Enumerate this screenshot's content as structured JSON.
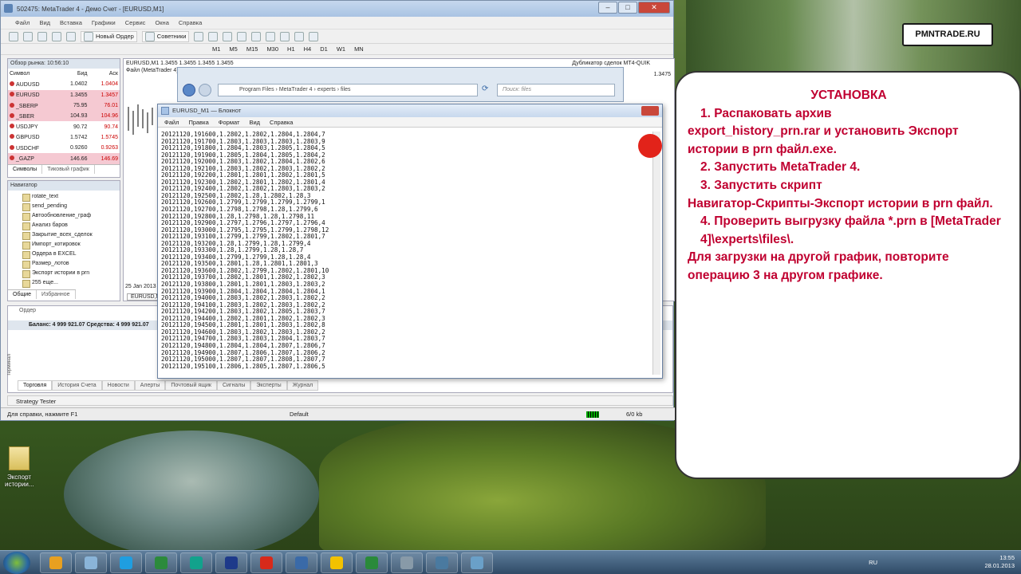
{
  "window": {
    "title": "502475: MetaTrader 4 - Демо Счет - [EURUSD,M1]"
  },
  "menu": [
    "Файл",
    "Вид",
    "Вставка",
    "Графики",
    "Сервис",
    "Окна",
    "Справка"
  ],
  "toolbar": {
    "new_order": "Новый Ордер",
    "advisors": "Советники",
    "timeframes": [
      "M1",
      "M5",
      "M15",
      "M30",
      "H1",
      "H4",
      "D1",
      "W1",
      "MN"
    ]
  },
  "market_watch": {
    "title": "Обзор рынка: 10:56:10",
    "headers": [
      "Символ",
      "Бид",
      "Аск"
    ],
    "rows": [
      {
        "symbol": "AUDUSD",
        "bid": "1.0402",
        "ask": "1.0404"
      },
      {
        "symbol": "EURUSD",
        "bid": "1.3455",
        "ask": "1.3457"
      },
      {
        "symbol": "_SBERP",
        "bid": "75.95",
        "ask": "76.01"
      },
      {
        "symbol": "_SBER",
        "bid": "104.93",
        "ask": "104.96"
      },
      {
        "symbol": "USDJPY",
        "bid": "90.72",
        "ask": "90.74"
      },
      {
        "symbol": "GBPUSD",
        "bid": "1.5742",
        "ask": "1.5745"
      },
      {
        "symbol": "USDCHF",
        "bid": "0.9260",
        "ask": "0.9263"
      },
      {
        "symbol": "_GAZP",
        "bid": "146.66",
        "ask": "146.69"
      }
    ],
    "tabs": [
      "Символы",
      "Тиковый график"
    ]
  },
  "navigator": {
    "title": "Навигатор",
    "items": [
      "rotate_text",
      "send_pending",
      "Автообновление_граф",
      "Анализ баров",
      "Закрытие_всех_сделок",
      "Импорт_котировок",
      "Ордера в EXCEL",
      "Размер_лотов",
      "Экспорт истории в prn",
      "255 еще..."
    ],
    "tabs": [
      "Общие",
      "Избранное"
    ]
  },
  "chart": {
    "title": "EURUSD,M1  1.3455 1.3455 1.3455 1.3455",
    "subtitle": "Файл (MetaTrader 4) xd",
    "dubl": "Дубликатор сделок MT4-QUIK",
    "price": "1.3475",
    "date": "25 Jan 2013",
    "tab": "EURUSD,M1"
  },
  "explorer": {
    "path": [
      "Program Files",
      "MetaTrader 4",
      "experts",
      "files"
    ],
    "search": "Поиск: files"
  },
  "notepad": {
    "title": "EURUSD_M1 — Блокнот",
    "menu": [
      "Файл",
      "Правка",
      "Формат",
      "Вид",
      "Справка"
    ],
    "lines": [
      "20121120,191600,1.2802,1.2802,1.2804,1.2804,7",
      "20121120,191700,1.2803,1.2803,1.2803,1.2803,9",
      "20121120,191800,1.2804,1.2803,1.2805,1.2804,5",
      "20121120,191900,1.2805,1.2804,1.2805,1.2804,2",
      "20121120,192000,1.2803,1.2802,1.2804,1.2802,6",
      "20121120,192100,1.2803,1.2802,1.2803,1.2802,2",
      "20121120,192200,1.2801,1.2801,1.2802,1.2801,5",
      "20121120,192300,1.2802,1.2801,1.2802,1.2801,4",
      "20121120,192400,1.2802,1.2802,1.2803,1.2803,2",
      "20121120,192500,1.2802,1.28,1.2802,1.28,3",
      "20121120,192600,1.2799,1.2799,1.2799,1.2799,1",
      "20121120,192700,1.2798,1.2798,1.28,1.2799,6",
      "20121120,192800,1.28,1.2798,1.28,1.2798,11",
      "20121120,192900,1.2797,1.2796,1.2797,1.2796,4",
      "20121120,193000,1.2795,1.2795,1.2799,1.2798,12",
      "20121120,193100,1.2799,1.2799,1.2802,1.2801,7",
      "20121120,193200,1.28,1.2799,1.28,1.2799,4",
      "20121120,193300,1.28,1.2799,1.28,1.28,7",
      "20121120,193400,1.2799,1.2799,1.28,1.28,4",
      "20121120,193500,1.2801,1.28,1.2801,1.2801,3",
      "20121120,193600,1.2802,1.2799,1.2802,1.2801,10",
      "20121120,193700,1.2802,1.2801,1.2802,1.2802,3",
      "20121120,193800,1.2801,1.2801,1.2803,1.2803,2",
      "20121120,193900,1.2804,1.2804,1.2804,1.2804,1",
      "20121120,194000,1.2803,1.2802,1.2803,1.2802,2",
      "20121120,194100,1.2803,1.2802,1.2803,1.2802,2",
      "20121120,194200,1.2803,1.2802,1.2805,1.2803,7",
      "20121120,194400,1.2802,1.2801,1.2802,1.2802,3",
      "20121120,194500,1.2801,1.2801,1.2803,1.2802,8",
      "20121120,194600,1.2803,1.2802,1.2803,1.2802,2",
      "20121120,194700,1.2803,1.2803,1.2804,1.2803,7",
      "20121120,194800,1.2804,1.2804,1.2807,1.2806,7",
      "20121120,194900,1.2807,1.2806,1.2807,1.2806,2",
      "20121120,195000,1.2807,1.2807,1.2808,1.2807,7",
      "20121120,195100,1.2806,1.2805,1.2807,1.2806,5"
    ]
  },
  "terminal": {
    "tab_order": "Ордер",
    "balance": "Баланс: 4 999 921.07  Средства: 4 999 921.07",
    "side_label": "Терминал",
    "tabs": [
      "Торговля",
      "История Счета",
      "Новости",
      "Алерты",
      "Почтовый ящик",
      "Сигналы",
      "Эксперты",
      "Журнал"
    ]
  },
  "strategy": "Strategy Tester",
  "statusbar": {
    "help": "Для справки, нажмите F1",
    "profile": "Default",
    "size": "6/0 kb"
  },
  "badge": "PMNTRADE.RU",
  "instructions": {
    "heading": "УСТАНОВКА",
    "lines": [
      "1. Распаковать архив",
      "export_history_prn.rar и установить Экспорт истории в prn файл.exe.",
      "2. Запустить MetaTrader 4.",
      "3. Запустить скрипт",
      "Навигатор-Скрипты-Экспорт истории в prn файл.",
      "4. Проверить выгрузку файла *.prn в [MetaTrader 4]\\experts\\files\\.",
      "Для загрузки на другой график, повторите операцию 3 на другом графике."
    ]
  },
  "desktop_icon": "Экспорт истории...",
  "taskbar": {
    "lang": "RU",
    "time": "13:55",
    "date": "28.01.2013",
    "app_colors": [
      "#e8a020",
      "#8ab4d8",
      "#1f9ee0",
      "#2c8a3c",
      "#12a28c",
      "#1e3a8a",
      "#d82a1a",
      "#3a6aa8",
      "#f2c200",
      "#2a8a3a",
      "#889aa8",
      "#4a7aa0",
      "#6aa0c8"
    ]
  }
}
